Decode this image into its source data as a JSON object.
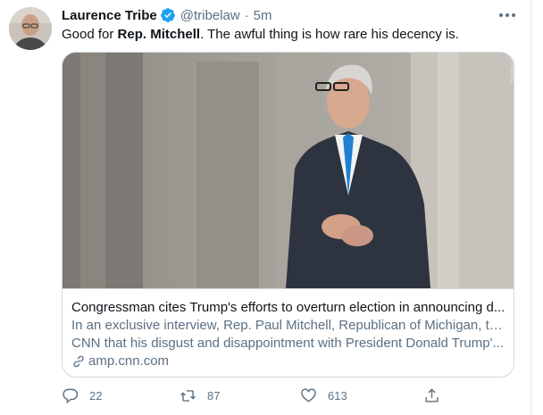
{
  "tweet": {
    "author_name": "Laurence Tribe",
    "handle": "@tribelaw",
    "separator": "·",
    "time": "5m",
    "text_before": "Good for ",
    "text_bold": "Rep. Mitchell",
    "text_after": ". The awful thing is how rare his decency is.",
    "icons": {
      "verified": "verified-badge-icon",
      "more": "more-options-icon"
    },
    "colors": {
      "accent": "#1da1f2",
      "secondary_text": "#5b7083",
      "border": "#cfd9de"
    }
  },
  "card": {
    "image_alt": "photo-of-congressman",
    "title": "Congressman cites Trump's efforts to overturn election in announcing d...",
    "description_line1": "In an exclusive interview, Rep. Paul Mitchell, Republican of Michigan, told",
    "description_line2": "CNN that his disgust and disappointment with President Donald Trump'...",
    "domain": "amp.cnn.com",
    "watermark": "AP PHOTOS"
  },
  "actions": {
    "reply_count": "22",
    "retweet_count": "87",
    "like_count": "613",
    "icons": {
      "reply": "reply-icon",
      "retweet": "retweet-icon",
      "like": "heart-icon",
      "share": "share-icon"
    }
  }
}
